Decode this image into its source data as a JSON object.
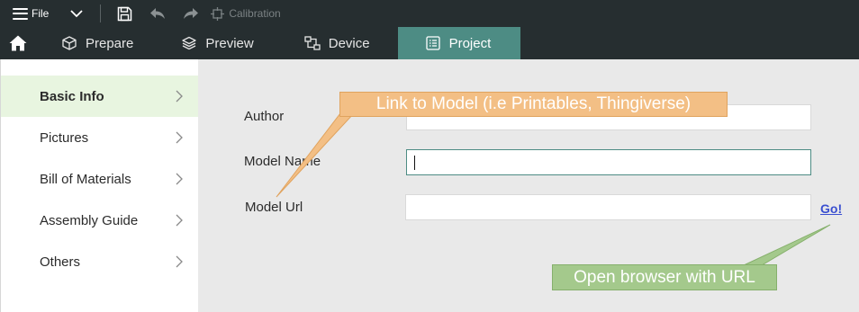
{
  "menubar": {
    "file_label": "File",
    "calibration_label": "Calibration",
    "icons": [
      "hamburger-menu-icon",
      "chevron-down-icon",
      "save-icon",
      "undo-icon",
      "redo-icon",
      "calibration-icon"
    ]
  },
  "tabs": [
    {
      "label": "Prepare",
      "icon": "cube-icon",
      "active": false
    },
    {
      "label": "Preview",
      "icon": "layers-icon",
      "active": false
    },
    {
      "label": "Device",
      "icon": "device-icon",
      "active": false
    },
    {
      "label": "Project",
      "icon": "project-icon",
      "active": true
    }
  ],
  "sidebar": {
    "items": [
      {
        "label": "Basic Info",
        "active": true
      },
      {
        "label": "Pictures",
        "active": false
      },
      {
        "label": "Bill of Materials",
        "active": false
      },
      {
        "label": "Assembly Guide",
        "active": false
      },
      {
        "label": "Others",
        "active": false
      }
    ]
  },
  "form": {
    "author_label": "Author",
    "author_value": "",
    "model_name_label": "Model Name",
    "model_name_value": "",
    "model_url_label": "Model Url",
    "model_url_value": "",
    "go_label": "Go!"
  },
  "annotations": {
    "link_callout": "Link to Model (i.e Printables, Thingiverse)",
    "browser_callout": "Open browser with URL"
  },
  "colors": {
    "topbar": "#262e30",
    "active_tab": "#4d8c84",
    "sidebar_active": "#e8f5e0",
    "orange_callout": "#f3bf85",
    "green_callout": "#a4c98c",
    "link": "#3a4fd0"
  }
}
